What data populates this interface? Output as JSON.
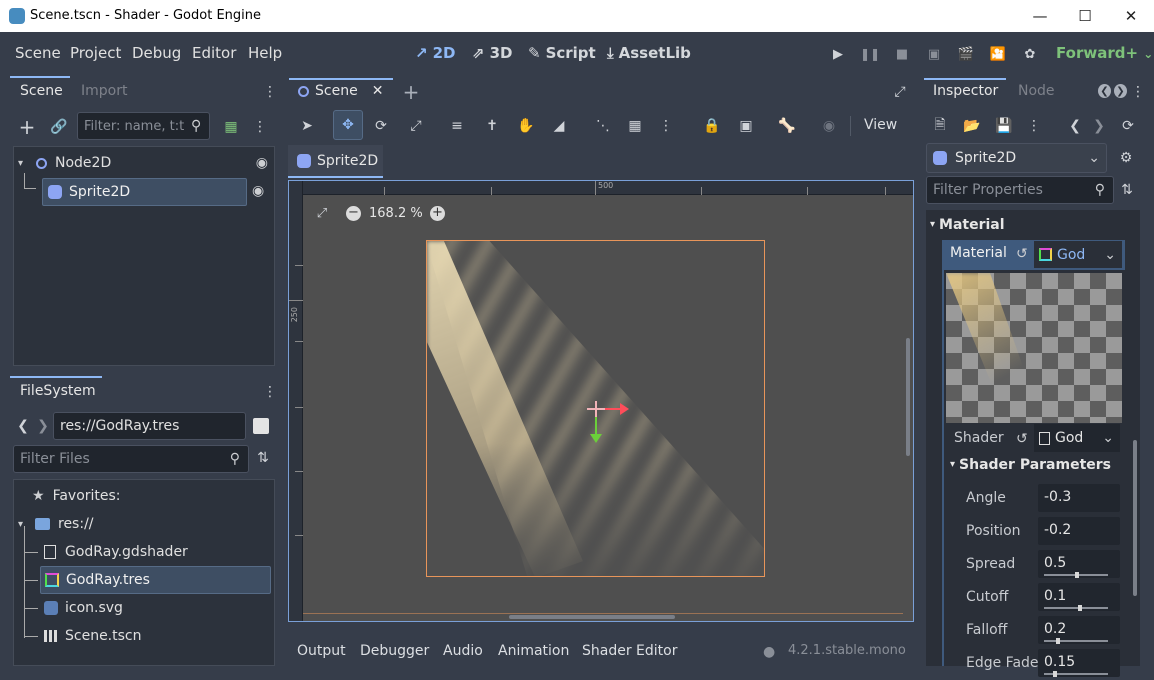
{
  "window": {
    "title": "Scene.tscn - Shader - Godot Engine"
  },
  "menu": [
    "Scene",
    "Project",
    "Debug",
    "Editor",
    "Help"
  ],
  "workspaces": [
    {
      "label": "2D",
      "icon": "2d-icon",
      "active": true
    },
    {
      "label": "3D",
      "icon": "3d-icon",
      "active": false
    },
    {
      "label": "Script",
      "icon": "script-icon",
      "active": false
    },
    {
      "label": "AssetLib",
      "icon": "assetlib-icon",
      "active": false
    }
  ],
  "renderer": "Forward+",
  "scene_dock": {
    "tabs": [
      "Scene",
      "Import"
    ],
    "filter_placeholder": "Filter: name, t:t",
    "tree": [
      {
        "label": "Node2D",
        "icon": "node2d-icon"
      },
      {
        "label": "Sprite2D",
        "icon": "sprite2d-icon",
        "selected": true
      }
    ]
  },
  "filesystem": {
    "title": "FileSystem",
    "path": "res://GodRay.tres",
    "filter_placeholder": "Filter Files",
    "favorites": "Favorites:",
    "root": "res://",
    "files": [
      {
        "label": "GodRay.gdshader",
        "icon": "shader-file-icon"
      },
      {
        "label": "GodRay.tres",
        "icon": "shader-material-icon",
        "selected": true
      },
      {
        "label": "icon.svg",
        "icon": "svg-icon"
      },
      {
        "label": "Scene.tscn",
        "icon": "scene-file-icon"
      }
    ]
  },
  "editor": {
    "scene_tab": "Scene",
    "view_label": "View",
    "breadcrumb": "Sprite2D",
    "zoom": "168.2 %",
    "ruler_top_mark": "500",
    "ruler_left_mark": "250"
  },
  "bottom_tabs": [
    "Output",
    "Debugger",
    "Audio",
    "Animation",
    "Shader Editor"
  ],
  "version": "4.2.1.stable.mono",
  "inspector": {
    "tabs": [
      "Inspector",
      "Node"
    ],
    "object": "Sprite2D",
    "filter_placeholder": "Filter Properties",
    "section": "Material",
    "material_label": "Material",
    "material_value": "God",
    "shader_label": "Shader",
    "shader_value": "God",
    "params_title": "Shader Parameters",
    "params": [
      {
        "name": "Angle",
        "value": "-0.3",
        "slider": null
      },
      {
        "name": "Position",
        "value": "-0.2",
        "slider": null
      },
      {
        "name": "Spread",
        "value": "0.5",
        "slider": 0.5
      },
      {
        "name": "Cutoff",
        "value": "0.1",
        "slider": 0.55
      },
      {
        "name": "Falloff",
        "value": "0.2",
        "slider": 0.2
      },
      {
        "name": "Edge Fade",
        "value": "0.15",
        "slider": 0.15
      }
    ]
  },
  "colors": {
    "accent": "#8eb8f5",
    "selection_outline": "#e8955a",
    "gizmo_x": "#ff4d5a",
    "gizmo_y": "#6bcf3a"
  }
}
